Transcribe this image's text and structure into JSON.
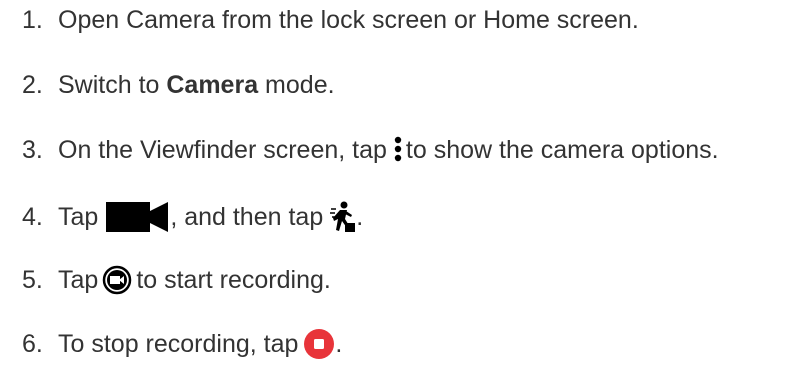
{
  "steps": [
    {
      "number": "1.",
      "text": "Open Camera from the lock screen or Home screen."
    },
    {
      "number": "2.",
      "pre": "Switch to ",
      "bold": "Camera",
      "post": " mode."
    },
    {
      "number": "3.",
      "pre": "On the Viewfinder screen, tap",
      "icon": "more-vertical-icon",
      "post": "to show the camera options."
    },
    {
      "number": "4.",
      "pre": "Tap",
      "icon": "video-camera-icon",
      "mid": ", and then tap",
      "icon2": "slow-motion-person-icon",
      "post": "."
    },
    {
      "number": "5.",
      "pre": "Tap",
      "icon": "record-button-icon",
      "post": "to start recording."
    },
    {
      "number": "6.",
      "pre": "To stop recording, tap",
      "icon": "stop-button-icon",
      "post": "."
    }
  ],
  "colors": {
    "text": "#333333",
    "icon": "#000000",
    "stop": "#e8343a"
  }
}
